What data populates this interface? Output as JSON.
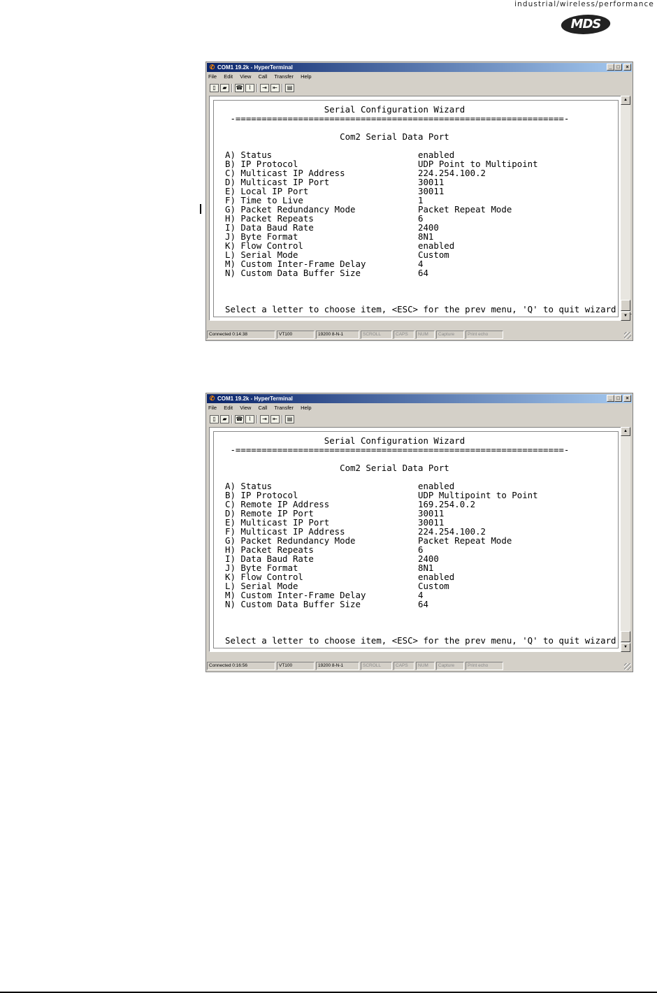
{
  "header": {
    "tagline": "industrial/wireless/performance",
    "logo_text": "MDS"
  },
  "windows": [
    {
      "title": "COM1 19.2k - HyperTerminal",
      "menu": [
        "File",
        "Edit",
        "View",
        "Call",
        "Transfer",
        "Help"
      ],
      "terminal_text": "                   Serial Configuration Wizard\n -===============================================================-\n\n                      Com2 Serial Data Port\n\nA) Status                            enabled\nB) IP Protocol                       UDP Point to Multipoint\nC) Multicast IP Address              224.254.100.2\nD) Multicast IP Port                 30011\nE) Local IP Port                     30011\nF) Time to Live                      1\nG) Packet Redundancy Mode            Packet Repeat Mode\nH) Packet Repeats                    6\nI) Data Baud Rate                    2400\nJ) Byte Format                       8N1\nK) Flow Control                      enabled\nL) Serial Mode                       Custom\nM) Custom Inter-Frame Delay          4\nN) Custom Data Buffer Size           64\n\n\n\nSelect a letter to choose item, <ESC> for the prev menu, 'Q' to quit wizard  _",
      "status": {
        "connected": "Connected 0:14:38",
        "emulation": "VT100",
        "settings": "19200 8-N-1",
        "scroll": "SCROLL",
        "caps": "CAPS",
        "num": "NUM",
        "capture": "Capture",
        "print_echo": "Print echo"
      }
    },
    {
      "title": "COM1 19.2k - HyperTerminal",
      "menu": [
        "File",
        "Edit",
        "View",
        "Call",
        "Transfer",
        "Help"
      ],
      "terminal_text": "                   Serial Configuration Wizard\n -===============================================================-\n\n                      Com2 Serial Data Port\n\nA) Status                            enabled\nB) IP Protocol                       UDP Multipoint to Point\nC) Remote IP Address                 169.254.0.2\nD) Remote IP Port                    30011\nE) Multicast IP Port                 30011\nF) Multicast IP Address              224.254.100.2\nG) Packet Redundancy Mode            Packet Repeat Mode\nH) Packet Repeats                    6\nI) Data Baud Rate                    2400\nJ) Byte Format                       8N1\nK) Flow Control                      enabled\nL) Serial Mode                       Custom\nM) Custom Inter-Frame Delay          4\nN) Custom Data Buffer Size           64\n\n\n\nSelect a letter to choose item, <ESC> for the prev menu, 'Q' to quit wizard",
      "status": {
        "connected": "Connected 0:16:56",
        "emulation": "VT100",
        "settings": "19200 8-N-1",
        "scroll": "SCROLL",
        "caps": "CAPS",
        "num": "NUM",
        "capture": "Capture",
        "print_echo": "Print echo"
      }
    }
  ]
}
